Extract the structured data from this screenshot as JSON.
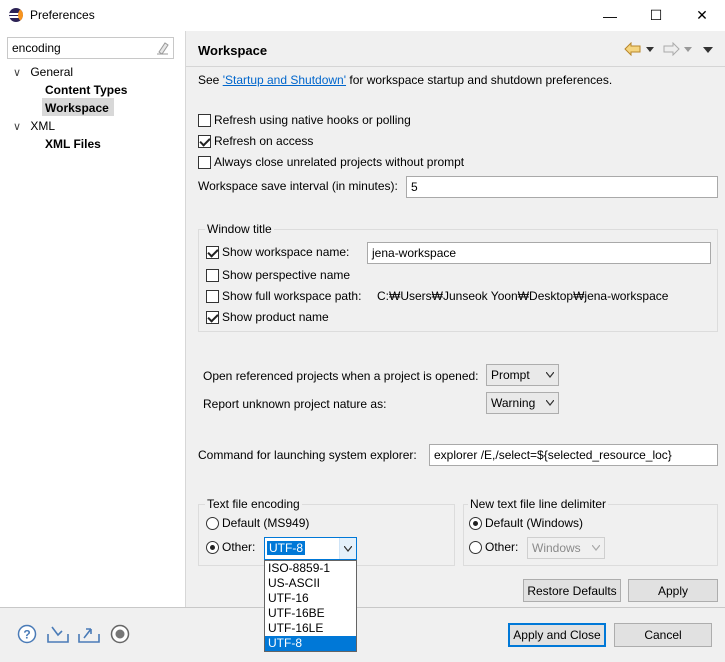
{
  "window": {
    "title": "Preferences",
    "min_glyph": "—",
    "max_glyph": "☐",
    "close_glyph": "✕"
  },
  "sidebar": {
    "filter_value": "encoding",
    "tree": [
      {
        "label": "General",
        "arrow": "∨"
      },
      {
        "label": "Content Types"
      },
      {
        "label": "Workspace"
      },
      {
        "label": "XML",
        "arrow": "∨"
      },
      {
        "label": "XML Files"
      }
    ]
  },
  "page": {
    "title": "Workspace",
    "intro_prefix": "See ",
    "intro_link": "'Startup and Shutdown'",
    "intro_suffix": " for workspace startup and shutdown preferences.",
    "refresh_native": "Refresh using native hooks or polling",
    "refresh_access": "Refresh on access",
    "close_unrelated": "Always close unrelated projects without prompt",
    "save_interval_label": "Workspace save interval (in minutes):",
    "save_interval_value": "5",
    "window_title": {
      "legend": "Window title",
      "show_name": "Show workspace name:",
      "name_value": "jena-workspace",
      "show_perspective": "Show perspective name",
      "show_path": "Show full workspace path:",
      "path_value": "C:₩Users₩Junseok Yoon₩Desktop₩jena-workspace",
      "show_product": "Show product name"
    },
    "open_ref_label": "Open referenced projects when a project is opened:",
    "open_ref_value": "Prompt",
    "unknown_nature_label": "Report unknown project nature as:",
    "unknown_nature_value": "Warning",
    "explorer_label": "Command for launching system explorer:",
    "explorer_value": "explorer /E,/select=${selected_resource_loc}",
    "encoding": {
      "legend": "Text file encoding",
      "default_label": "Default (MS949)",
      "other_label": "Other:",
      "other_value": "UTF-8",
      "options": [
        "ISO-8859-1",
        "US-ASCII",
        "UTF-16",
        "UTF-16BE",
        "UTF-16LE",
        "UTF-8"
      ]
    },
    "line_delim": {
      "legend": "New text file line delimiter",
      "default_label": "Default (Windows)",
      "other_label": "Other:",
      "other_value": "Windows"
    },
    "restore_defaults": "Restore Defaults",
    "apply": "Apply"
  },
  "footer": {
    "apply_close": "Apply and Close",
    "cancel": "Cancel"
  },
  "colors": {
    "selection": "#0078d7",
    "link": "#0066cc",
    "dialog_bg": "#f0f0f0"
  }
}
